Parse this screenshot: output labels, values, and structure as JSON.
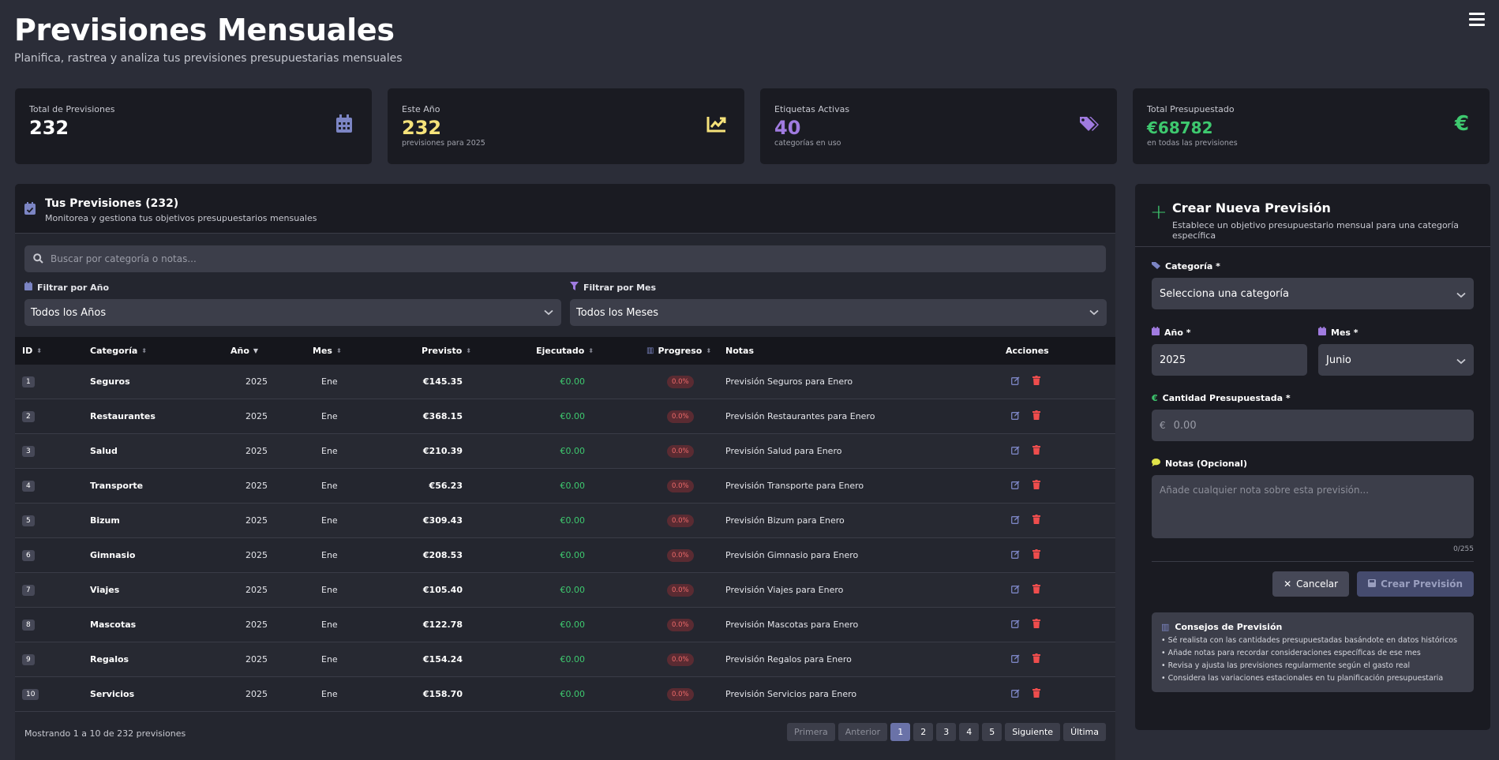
{
  "header": {
    "title": "Previsiones Mensuales",
    "subtitle": "Planifica, rastrea y analiza tus previsiones presupuestarias mensuales"
  },
  "stats": [
    {
      "label": "Total de Previsiones",
      "value": "232",
      "sub": "",
      "color": "#ffffff",
      "icon": "calendar-icon"
    },
    {
      "label": "Este Año",
      "value": "232",
      "sub": "previsiones para 2025",
      "color": "#f5e27a",
      "icon": "trend-up-icon"
    },
    {
      "label": "Etiquetas Activas",
      "value": "40",
      "sub": "categorías en uso",
      "color": "#a07be0",
      "icon": "tags-icon"
    },
    {
      "label": "Total Presupuestado",
      "value": "€68782",
      "sub": "en todas las previsiones",
      "color": "#3ec96f",
      "icon": "euro-icon"
    }
  ],
  "panel": {
    "title": "Tus Previsiones (232)",
    "desc": "Monitorea y gestiona tus objetivos presupuestarios mensuales",
    "search_placeholder": "Buscar por categoría o notas...",
    "filter_year_label": "Filtrar por Año",
    "filter_year_value": "Todos los Años",
    "filter_month_label": "Filtrar por Mes",
    "filter_month_value": "Todos los Meses"
  },
  "table": {
    "headers": [
      "ID",
      "Categoría",
      "Año",
      "Mes",
      "Previsto",
      "Ejecutado",
      "Progreso",
      "Notas",
      "Acciones"
    ],
    "rows": [
      {
        "id": "1",
        "cat": "Seguros",
        "year": "2025",
        "month": "Ene",
        "prev": "€145.35",
        "ejec": "€0.00",
        "prog": "0.0%",
        "notes": "Previsión Seguros para Enero"
      },
      {
        "id": "2",
        "cat": "Restaurantes",
        "year": "2025",
        "month": "Ene",
        "prev": "€368.15",
        "ejec": "€0.00",
        "prog": "0.0%",
        "notes": "Previsión Restaurantes para Enero"
      },
      {
        "id": "3",
        "cat": "Salud",
        "year": "2025",
        "month": "Ene",
        "prev": "€210.39",
        "ejec": "€0.00",
        "prog": "0.0%",
        "notes": "Previsión Salud para Enero"
      },
      {
        "id": "4",
        "cat": "Transporte",
        "year": "2025",
        "month": "Ene",
        "prev": "€56.23",
        "ejec": "€0.00",
        "prog": "0.0%",
        "notes": "Previsión Transporte para Enero"
      },
      {
        "id": "5",
        "cat": "Bizum",
        "year": "2025",
        "month": "Ene",
        "prev": "€309.43",
        "ejec": "€0.00",
        "prog": "0.0%",
        "notes": "Previsión Bizum para Enero"
      },
      {
        "id": "6",
        "cat": "Gimnasio",
        "year": "2025",
        "month": "Ene",
        "prev": "€208.53",
        "ejec": "€0.00",
        "prog": "0.0%",
        "notes": "Previsión Gimnasio para Enero"
      },
      {
        "id": "7",
        "cat": "Viajes",
        "year": "2025",
        "month": "Ene",
        "prev": "€105.40",
        "ejec": "€0.00",
        "prog": "0.0%",
        "notes": "Previsión Viajes para Enero"
      },
      {
        "id": "8",
        "cat": "Mascotas",
        "year": "2025",
        "month": "Ene",
        "prev": "€122.78",
        "ejec": "€0.00",
        "prog": "0.0%",
        "notes": "Previsión Mascotas para Enero"
      },
      {
        "id": "9",
        "cat": "Regalos",
        "year": "2025",
        "month": "Ene",
        "prev": "€154.24",
        "ejec": "€0.00",
        "prog": "0.0%",
        "notes": "Previsión Regalos para Enero"
      },
      {
        "id": "10",
        "cat": "Servicios",
        "year": "2025",
        "month": "Ene",
        "prev": "€158.70",
        "ejec": "€0.00",
        "prog": "0.0%",
        "notes": "Previsión Servicios para Enero"
      }
    ]
  },
  "footer": {
    "info": "Mostrando 1 a 10 de 232 previsiones",
    "pager": [
      "Primera",
      "Anterior",
      "1",
      "2",
      "3",
      "4",
      "5",
      "Siguiente",
      "Última"
    ]
  },
  "form": {
    "title": "Crear Nueva Previsión",
    "desc": "Establece un objetivo presupuestario mensual para una categoría específica",
    "category_label": "Categoría *",
    "category_value": "Selecciona una categoría",
    "year_label": "Año *",
    "year_value": "2025",
    "month_label": "Mes *",
    "month_value": "Junio",
    "amount_label": "Cantidad Presupuestada *",
    "amount_prefix": "€",
    "amount_placeholder": "0.00",
    "notes_label": "Notas (Opcional)",
    "notes_placeholder": "Añade cualquier nota sobre esta previsión...",
    "counter": "0/255",
    "cancel": "Cancelar",
    "create": "Crear Previsión"
  },
  "tips": {
    "title": "Consejos de Previsión",
    "items": [
      "• Sé realista con las cantidades presupuestadas basándote en datos históricos",
      "• Añade notas para recordar consideraciones específicas de ese mes",
      "• Revisa y ajusta las previsiones regularmente según el gasto real",
      "• Considera las variaciones estacionales en tu planificación presupuestaria"
    ]
  },
  "colors": {
    "accent": "#6a72a8",
    "green": "#3ec96f",
    "red": "#ef4d4d",
    "purple": "#a07be0",
    "yellow": "#f5e27a"
  }
}
